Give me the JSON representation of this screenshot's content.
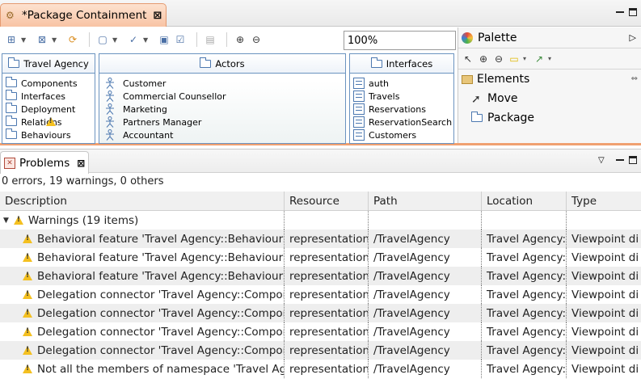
{
  "editor": {
    "tab_title": "*Package Containment",
    "close_glyph": "⊠",
    "zoom": "100%"
  },
  "diagram": {
    "containers": [
      {
        "title": "Travel Agency",
        "items": [
          "Components",
          "Interfaces",
          "Deployment",
          "Relations",
          "Behaviours"
        ]
      },
      {
        "title": "Actors",
        "items": [
          "Customer",
          "Commercial Counsellor",
          "Marketing",
          "Partners Manager",
          "Accountant"
        ]
      },
      {
        "title": "Interfaces",
        "items": [
          "auth",
          "Travels",
          "Reservations",
          "ReservationSearch",
          "Customers"
        ]
      }
    ]
  },
  "palette": {
    "title": "Palette",
    "drawer": "Elements",
    "entries": [
      "Move",
      "Package"
    ]
  },
  "problems": {
    "tab_title": "Problems",
    "summary": "0 errors, 19 warnings, 0 others",
    "columns": [
      "Description",
      "Resource",
      "Path",
      "Location",
      "Type"
    ],
    "group_label": "Warnings (19 items)",
    "rows": [
      [
        "Behavioral feature 'Travel Agency::Behaviours",
        "representation",
        "/TravelAgency",
        "Travel Agency::",
        "Viewpoint di"
      ],
      [
        "Behavioral feature 'Travel Agency::Behaviours",
        "representation",
        "/TravelAgency",
        "Travel Agency::",
        "Viewpoint di"
      ],
      [
        "Behavioral feature 'Travel Agency::Behaviours",
        "representation",
        "/TravelAgency",
        "Travel Agency::",
        "Viewpoint di"
      ],
      [
        "Delegation connector 'Travel Agency::Compor",
        "representation",
        "/TravelAgency",
        "Travel Agency::",
        "Viewpoint di"
      ],
      [
        "Delegation connector 'Travel Agency::Compor",
        "representation",
        "/TravelAgency",
        "Travel Agency::",
        "Viewpoint di"
      ],
      [
        "Delegation connector 'Travel Agency::Compor",
        "representation",
        "/TravelAgency",
        "Travel Agency::",
        "Viewpoint di"
      ],
      [
        "Delegation connector 'Travel Agency::Compor",
        "representation",
        "/TravelAgency",
        "Travel Agency::",
        "Viewpoint di"
      ],
      [
        "Not all the members of namespace 'Travel Age",
        "representation",
        "/TravelAgency",
        "Travel Agency::",
        "Viewpoint di"
      ]
    ]
  }
}
